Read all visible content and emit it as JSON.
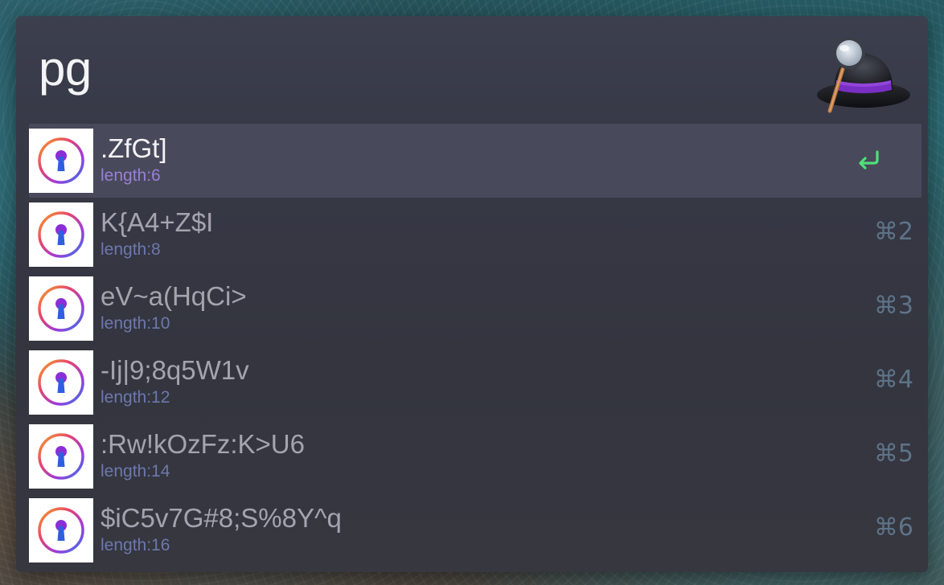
{
  "search": {
    "query": "pg"
  },
  "results": [
    {
      "title": ".ZfGt]",
      "subtitle": "length:6",
      "shortcut": "",
      "selected": true,
      "icon": "keyhole-icon"
    },
    {
      "title": "K{A4+Z$I",
      "subtitle": "length:8",
      "shortcut": "⌘2",
      "selected": false,
      "icon": "keyhole-icon"
    },
    {
      "title": "eV~a(HqCi>",
      "subtitle": "length:10",
      "shortcut": "⌘3",
      "selected": false,
      "icon": "keyhole-icon"
    },
    {
      "title": "-Ij|9;8q5W1v",
      "subtitle": "length:12",
      "shortcut": "⌘4",
      "selected": false,
      "icon": "keyhole-icon"
    },
    {
      "title": ":Rw!kOzFz:K>U6",
      "subtitle": "length:14",
      "shortcut": "⌘5",
      "selected": false,
      "icon": "keyhole-icon"
    },
    {
      "title": "$iC5v7G#8;S%8Y^q",
      "subtitle": "length:16",
      "shortcut": "⌘6",
      "selected": false,
      "icon": "keyhole-icon"
    }
  ],
  "icons": {
    "app_logo": "alfred-hat-logo",
    "result_icon": "keyhole-icon",
    "selected_action": "return-arrow-icon"
  },
  "colors": {
    "selected_row_bg": "#484a5b",
    "return_arrow": "#4fe07a",
    "selected_subtitle": "#9a7fd6",
    "subtitle": "#6d78ad",
    "shortcut": "#5e7388"
  }
}
